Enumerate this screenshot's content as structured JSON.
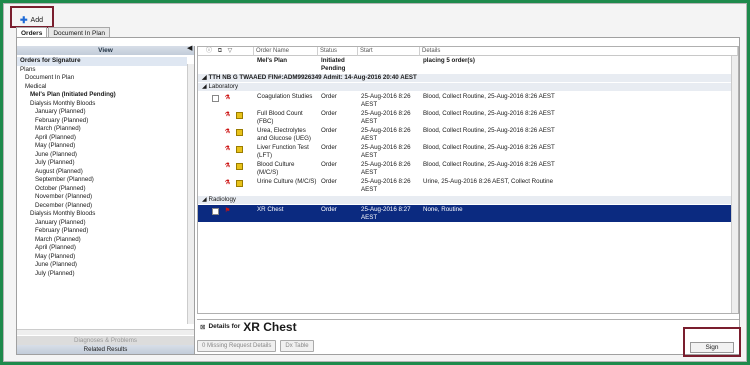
{
  "toolbar": {
    "add_label": "Add"
  },
  "tabs": [
    {
      "label": "Orders"
    },
    {
      "label": "Document In Plan"
    }
  ],
  "left_panel": {
    "view_header": "View",
    "tree": [
      {
        "label": "Orders for Signature",
        "bold": true
      },
      {
        "label": "Plans"
      },
      {
        "label": "Document In Plan",
        "indent": 1
      },
      {
        "label": "Medical",
        "indent": 1
      },
      {
        "label": "Mel's Plan (Initiated Pending)",
        "indent": 2,
        "bold": true
      },
      {
        "label": "Dialysis Monthly Bloods",
        "indent": 2
      },
      {
        "label": "January (Planned)",
        "indent": 3
      },
      {
        "label": "February (Planned)",
        "indent": 3
      },
      {
        "label": "March (Planned)",
        "indent": 3
      },
      {
        "label": "April (Planned)",
        "indent": 3
      },
      {
        "label": "May (Planned)",
        "indent": 3
      },
      {
        "label": "June (Planned)",
        "indent": 3
      },
      {
        "label": "July (Planned)",
        "indent": 3
      },
      {
        "label": "August (Planned)",
        "indent": 3
      },
      {
        "label": "September (Planned)",
        "indent": 3
      },
      {
        "label": "October (Planned)",
        "indent": 3
      },
      {
        "label": "November (Planned)",
        "indent": 3
      },
      {
        "label": "December (Planned)",
        "indent": 3
      },
      {
        "label": "Dialysis Monthly Bloods",
        "indent": 2
      },
      {
        "label": "January (Planned)",
        "indent": 3
      },
      {
        "label": "February (Planned)",
        "indent": 3
      },
      {
        "label": "March (Planned)",
        "indent": 3
      },
      {
        "label": "April (Planned)",
        "indent": 3
      },
      {
        "label": "May (Planned)",
        "indent": 3
      },
      {
        "label": "June (Planned)",
        "indent": 3
      },
      {
        "label": "July (Planned)",
        "indent": 3
      }
    ],
    "bottom_items": [
      "Diagnoses & Problems",
      "Related Results"
    ]
  },
  "grid": {
    "columns": [
      "Order Name",
      "Status",
      "Start",
      "Details"
    ],
    "plan_row": {
      "name": "Mel's Plan",
      "status": "Initiated Pending",
      "details": "placing 5 order(s)"
    },
    "patient_row": "TTH NB G TWAAED  FIN#:ADM9926349  Admit: 14-Aug-2016 20:40 AEST",
    "groups": [
      {
        "label": "Laboratory",
        "orders": [
          {
            "name": "Coagulation Studies",
            "status": "Order",
            "start": "25-Aug-2016 8:26 AEST",
            "details": "Blood, Collect Routine, 25-Aug-2016 8:26 AEST"
          },
          {
            "name": "Full Blood Count (FBC)",
            "status": "Order",
            "start": "25-Aug-2016 8:26 AEST",
            "details": "Blood, Collect Routine, 25-Aug-2016 8:26 AEST"
          },
          {
            "name": "Urea, Electrolytes and Glucose (UEG)",
            "status": "Order",
            "start": "25-Aug-2016 8:26 AEST",
            "details": "Blood, Collect Routine, 25-Aug-2016 8:26 AEST"
          },
          {
            "name": "Liver Function Test (LFT)",
            "status": "Order",
            "start": "25-Aug-2016 8:26 AEST",
            "details": "Blood, Collect Routine, 25-Aug-2016 8:26 AEST"
          },
          {
            "name": "Blood Culture (M/C/S)",
            "status": "Order",
            "start": "25-Aug-2016 8:26 AEST",
            "details": "Blood, Collect Routine, 25-Aug-2016 8:26 AEST"
          },
          {
            "name": "Urine Culture (M/C/S)",
            "status": "Order",
            "start": "25-Aug-2016 8:26 AEST",
            "details": "Urine, 25-Aug-2016 8:26 AEST, Collect Routine"
          }
        ]
      },
      {
        "label": "Radiology",
        "orders": [
          {
            "name": "XR Chest",
            "status": "Order",
            "start": "25-Aug-2016 8:27 AEST",
            "details": "None, Routine",
            "selected": true
          }
        ]
      }
    ]
  },
  "details_bar": {
    "label": "Details for",
    "order": "XR Chest"
  },
  "bottom_buttons": {
    "missing": "0 Missing Request Details",
    "table": "Dx Table"
  },
  "sign_label": "Sign"
}
